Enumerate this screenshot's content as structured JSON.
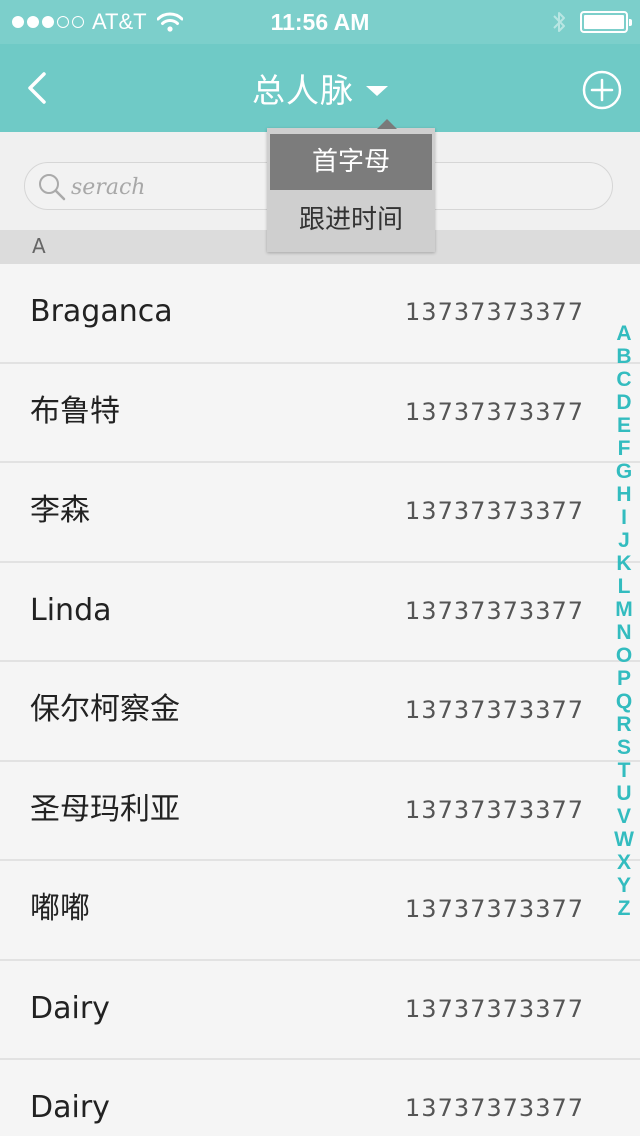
{
  "status_bar": {
    "carrier": "AT&T",
    "time": "11:56 AM",
    "signal_strength": 3,
    "signal_max": 5,
    "battery_level": 1.0
  },
  "nav": {
    "title": "总人脉",
    "back_icon": "chevron-left-icon",
    "add_icon": "plus-circle-icon"
  },
  "dropdown": {
    "items": [
      {
        "label": "首字母",
        "selected": true
      },
      {
        "label": "跟进时间",
        "selected": false
      }
    ]
  },
  "search": {
    "placeholder": "serach"
  },
  "section": {
    "letter": "A"
  },
  "contacts": [
    {
      "name": "Braganca",
      "phone": "13737373377"
    },
    {
      "name": "布鲁特",
      "phone": "13737373377"
    },
    {
      "name": "李森",
      "phone": "13737373377"
    },
    {
      "name": "Linda",
      "phone": "13737373377"
    },
    {
      "name": "保尔柯察金",
      "phone": "13737373377"
    },
    {
      "name": "圣母玛利亚",
      "phone": "13737373377"
    },
    {
      "name": "嘟嘟",
      "phone": "13737373377"
    },
    {
      "name": "Dairy",
      "phone": "13737373377"
    },
    {
      "name": "Dairy",
      "phone": "13737373377"
    }
  ],
  "index_letters": [
    "A",
    "B",
    "C",
    "D",
    "E",
    "F",
    "G",
    "H",
    "I",
    "J",
    "K",
    "L",
    "M",
    "N",
    "O",
    "P",
    "Q",
    "R",
    "S",
    "T",
    "U",
    "V",
    "W",
    "X",
    "Y",
    "Z"
  ],
  "colors": {
    "nav_bar": "#6fcac6",
    "status_bar": "#7ccfcb",
    "index_accent": "#33bcbf",
    "dropdown_selected": "#7c7c7c"
  }
}
